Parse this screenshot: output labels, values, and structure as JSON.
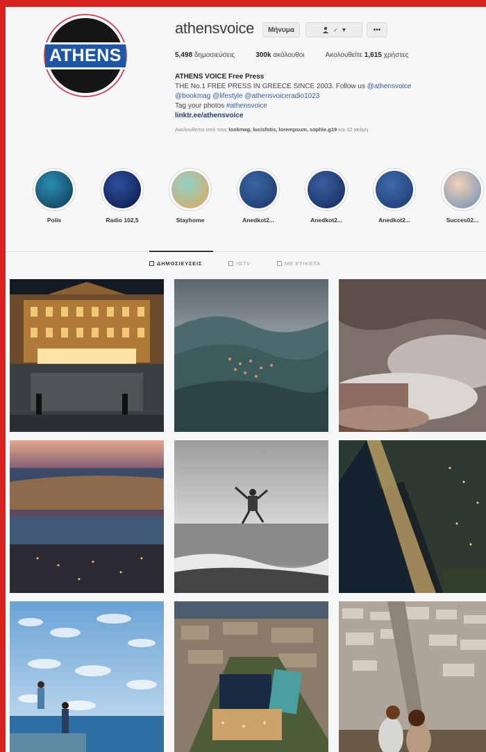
{
  "profile": {
    "avatar_text": "ATHENS",
    "username": "athensvoice",
    "buttons": {
      "message": "Μήνυμα",
      "follow_arrow": "▾",
      "more": "•••"
    },
    "stats": {
      "posts_value": "5,498",
      "posts_label": "δημοσιεύσεις",
      "followers_value": "300k",
      "followers_label": "ακόλουθοι",
      "following_label": "Ακολουθείτε",
      "following_value": "1,615",
      "following_suffix": "χρήστες"
    },
    "bio": {
      "name": "ATHENS VOICE Free Press",
      "line1_prefix": "THE No.1 FREE PRESS IN GREECE SINCE 2003. Follow us ",
      "line1_link": "@athensvoice",
      "line2": "@bookmag @lifestyle @athensvoiceradio1023",
      "line3_prefix": "Tag your photos ",
      "line3_tag": "#athensvoice",
      "url": "linktr.ee/athensvoice",
      "followed_by_prefix": "Ακολουθείται από τους ",
      "followed_by_names": "lookmag, lucisfotis, lorempsum, sophie.g19",
      "followed_by_suffix": " και 32 ακόμη"
    }
  },
  "highlights": [
    {
      "label": "Polis",
      "color_a": "#2b8fb0",
      "color_b": "#0f3551"
    },
    {
      "label": "Radio 102,5",
      "color_a": "#2c4f9e",
      "color_b": "#0b1845"
    },
    {
      "label": "Stayhome",
      "color_a": "#8fd3c9",
      "color_b": "#e4a45a"
    },
    {
      "label": "Anedkot2...",
      "color_a": "#3a66a3",
      "color_b": "#1a3566"
    },
    {
      "label": "Anedkot2...",
      "color_a": "#3a5fa0",
      "color_b": "#15285a"
    },
    {
      "label": "Anedkot2...",
      "color_a": "#3f6aa8",
      "color_b": "#1b3870"
    },
    {
      "label": "Succes02...",
      "color_a": "#f1d0b5",
      "color_b": "#6b8fb8"
    }
  ],
  "tabs": [
    {
      "label": "ΔΗΜΟΣΙΕΥΣΕΙΣ",
      "active": true
    },
    {
      "label": "IGTV",
      "active": false
    },
    {
      "label": "ΜΕ ΕΤΙΚΕΤΑ",
      "active": false
    }
  ],
  "posts": [
    {
      "alt": "parliament"
    },
    {
      "alt": "mountains"
    },
    {
      "alt": "smoke"
    },
    {
      "alt": "harbor-dusk"
    },
    {
      "alt": "jumper"
    },
    {
      "alt": "night-coast"
    },
    {
      "alt": "kids-sky"
    },
    {
      "alt": "city-aerial"
    },
    {
      "alt": "couple-view"
    }
  ]
}
